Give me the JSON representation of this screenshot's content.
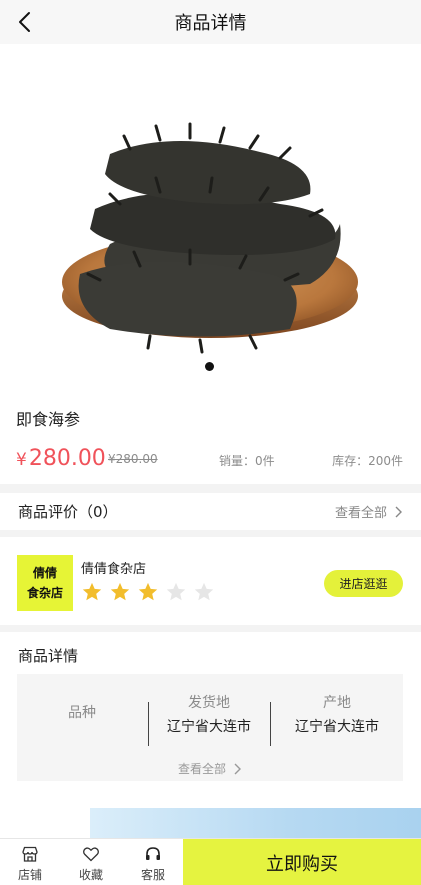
{
  "header": {
    "title": "商品详情",
    "back_icon": "chevron-left-icon"
  },
  "product": {
    "name": "即食海参",
    "currency": "¥",
    "price": "280.00",
    "original_price": "¥280.00",
    "sales": "销量：0件",
    "stock": "库存：200件",
    "image_count": 1,
    "active_image_index": 0
  },
  "reviews": {
    "label": "商品评价（0）",
    "view_all": "查看全部"
  },
  "shop": {
    "logo_line1": "倩倩",
    "logo_line2": "食杂店",
    "name": "倩倩食杂店",
    "rating": 3,
    "rating_max": 5,
    "visit_button": "进店逛逛"
  },
  "details": {
    "label": "商品详情",
    "specs": [
      {
        "key": "品种",
        "value": ""
      },
      {
        "key": "发货地",
        "value": "辽宁省大连市"
      },
      {
        "key": "产地",
        "value": "辽宁省大连市"
      }
    ],
    "view_all": "查看全部"
  },
  "bottom_bar": {
    "tabs": [
      {
        "label": "店铺",
        "icon": "store-icon"
      },
      {
        "label": "收藏",
        "icon": "heart-icon"
      },
      {
        "label": "客服",
        "icon": "headset-icon"
      }
    ],
    "buy_button": "立即购买"
  },
  "colors": {
    "accent": "#e5f340",
    "price": "#f0525a"
  }
}
